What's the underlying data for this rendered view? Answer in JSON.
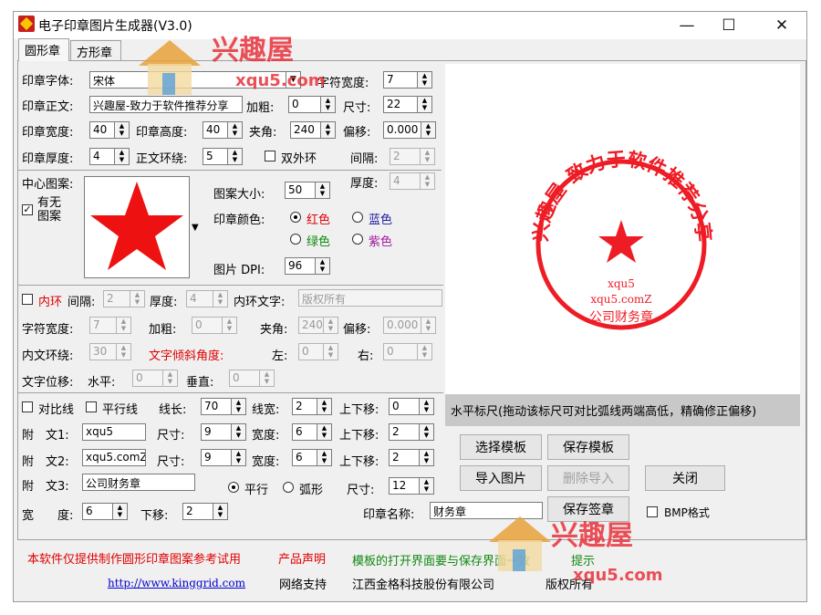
{
  "window": {
    "title": "电子印章图片生成器(V3.0)",
    "minimize_glyph": "—",
    "maximize_glyph": "☐",
    "close_glyph": "✕"
  },
  "tabs": [
    {
      "label": "圆形章"
    },
    {
      "label": "方形章"
    }
  ],
  "watermark": {
    "brand": "兴趣屋",
    "url": "xqu5.com"
  },
  "seal": {
    "font_label": "印章字体:",
    "font_value": "宋体",
    "char_width_label": "字符宽度:",
    "char_width": "7",
    "main_text_label": "印章正文:",
    "main_text": "兴趣屋-致力于软件推荐分享",
    "bold_label": "加粗:",
    "bold": "0",
    "size_label": "尺寸:",
    "size": "22",
    "width_label": "印章宽度:",
    "width": "40",
    "height_label": "印章高度:",
    "height": "40",
    "angle_label": "夹角:",
    "angle": "240",
    "offset_label": "偏移:",
    "offset": "0.000",
    "thickness_label": "印章厚度:",
    "thickness": "4",
    "ring_label": "正文环绕:",
    "ring": "5",
    "double_outer_label": "双外环",
    "gap_label": "间隔:",
    "gap": "2",
    "outer_thickness_label": "厚度:",
    "outer_thickness": "4"
  },
  "center": {
    "label": "中心图案:",
    "has_label": "有无图案",
    "pattern_size_label": "图案大小:",
    "pattern_size": "50",
    "color_label": "印章颜色:",
    "colors": [
      {
        "label": "红色"
      },
      {
        "label": "蓝色"
      },
      {
        "label": "绿色"
      },
      {
        "label": "紫色"
      }
    ],
    "dpi_label": "图片 DPI:",
    "dpi": "96"
  },
  "inner": {
    "inner_ring_label": "内环",
    "gap_label": "间隔:",
    "gap": "2",
    "thickness_label": "厚度:",
    "thickness": "4",
    "inner_text_label": "内环文字:",
    "inner_text": "版权所有",
    "char_width_label": "字符宽度:",
    "char_width": "7",
    "bold_label": "加粗:",
    "bold": "0",
    "angle_label": "夹角:",
    "angle": "240",
    "offset_label": "偏移:",
    "offset": "0.000",
    "ring_label": "内文环绕:",
    "ring": "30",
    "tilt_label": "文字倾斜角度:",
    "left_label": "左:",
    "left": "0",
    "right_label": "右:",
    "right": "0",
    "pos_label": "文字位移:",
    "h_label": "水平:",
    "h": "0",
    "v_label": "垂直:",
    "v": "0"
  },
  "compare": {
    "compare_line_label": "对比线",
    "parallel_line_label": "平行线",
    "line_length_label": "线长:",
    "line_length": "70",
    "line_width_label": "线宽:",
    "line_width": "2",
    "updown_label": "上下移:",
    "updown": "0"
  },
  "attach": [
    {
      "label": "附　文1:",
      "text": "xqu5",
      "size_label": "尺寸:",
      "size": "9",
      "width_label": "宽度:",
      "width": "6",
      "updown_label": "上下移:",
      "updown": "2"
    },
    {
      "label": "附　文2:",
      "text": "xqu5.comZ",
      "size_label": "尺寸:",
      "size": "9",
      "width_label": "宽度:",
      "width": "6",
      "updown_label": "上下移:",
      "updown": "2"
    },
    {
      "label": "附　文3:",
      "text": "公司财务章",
      "parallel_label": "平行",
      "arc_label": "弧形",
      "size_label": "尺寸:",
      "size": "12"
    }
  ],
  "misc": {
    "width_label": "宽　　度:",
    "width": "6",
    "down_label": "下移:",
    "down": "2",
    "seal_name_label": "印章名称:",
    "seal_name": "财务章"
  },
  "preview": {
    "center_text": "xqu5",
    "sub_text": "xqu5.comZ",
    "bottom_text": "公司财务章",
    "ring_text": "兴趣屋-致力于软件推荐分享",
    "ruler_text": "水平标尺(拖动该标尺可对比弧线两端高低，精确修正偏移)",
    "color": "#ee1c25"
  },
  "buttons": {
    "choose_template": "选择模板",
    "save_template": "保存模板",
    "import_image": "导入图片",
    "delete_import": "删除导入",
    "close": "关闭",
    "save_seal": "保存签章",
    "bmp_label": "BMP格式"
  },
  "footer": {
    "note": "本软件仅提供制作圆形印章图案参考试用",
    "statement": "产品声明",
    "template_note": "模板的打开界面要与保存界面一致",
    "tip": "提示",
    "link": "http://www.kinggrid.com",
    "support": "网络支持",
    "company": "江西金格科技股份有限公司",
    "rights": "版权所有"
  }
}
